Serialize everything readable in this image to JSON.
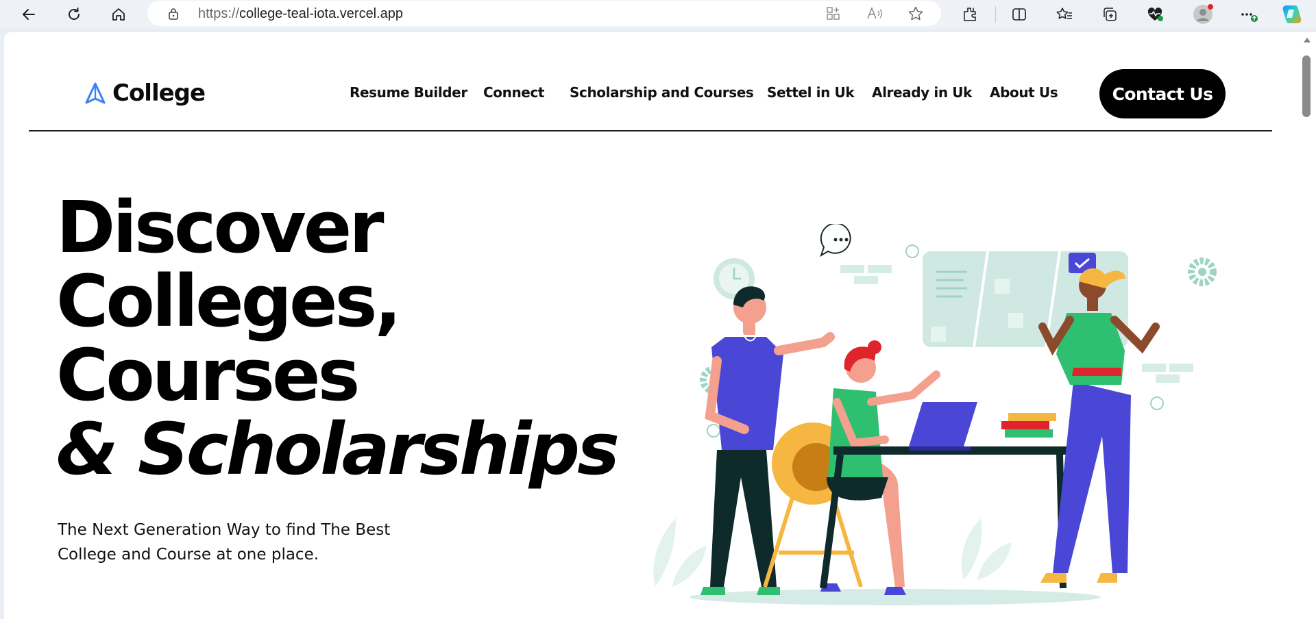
{
  "browser": {
    "url_protocol": "https://",
    "url_host": "college-teal-iota.vercel.app"
  },
  "site": {
    "logo_text": "College",
    "nav": [
      {
        "label": "Resume Builder"
      },
      {
        "label": "Connect"
      },
      {
        "label": "Scholarship and Courses"
      },
      {
        "label": "Settel in Uk"
      },
      {
        "label": "Already in Uk"
      },
      {
        "label": "About Us"
      }
    ],
    "contact_label": "Contact Us",
    "colors": {
      "logo_accent": "#3b82f6",
      "button_bg": "#000000",
      "illustration_purple": "#4b47d6",
      "illustration_green": "#2fbf71",
      "illustration_yellow": "#f5b642"
    }
  },
  "hero": {
    "line1": "Discover",
    "line2": "Colleges,",
    "line3": "Courses",
    "line4": "& Scholarships",
    "subtitle": "The Next Generation Way to find The Best College and Course at one place."
  }
}
